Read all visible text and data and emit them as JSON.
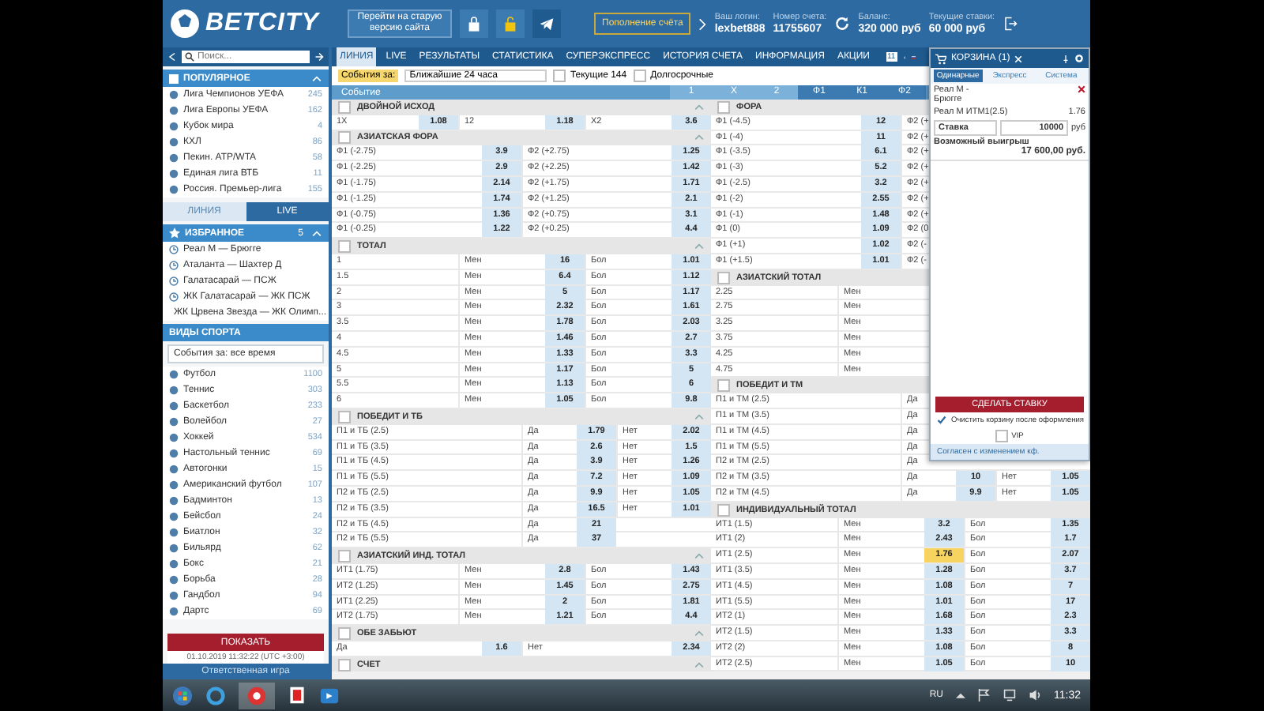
{
  "header": {
    "logo": "BETCITY",
    "old_site_button": "Перейти на старую версию сайта",
    "deposit_button": "Пополнение счёта",
    "account": [
      {
        "label": "Ваш логин:",
        "value": "lexbet888"
      },
      {
        "label": "Номер счета:",
        "value": "11755607"
      },
      {
        "label": "Баланс:",
        "value": "320 000 руб"
      },
      {
        "label": "Текущие ставки:",
        "value": "60 000 руб"
      }
    ]
  },
  "nav": {
    "search_placeholder": "Поиск...",
    "badge": "11",
    "items": [
      {
        "label": "ЛИНИЯ",
        "selected": true
      },
      {
        "label": "LIVE",
        "selected": false
      },
      {
        "label": "РЕЗУЛЬТАТЫ",
        "selected": false
      },
      {
        "label": "СТАТИСТИКА",
        "selected": false
      },
      {
        "label": "СУПЕРЭКСПРЕСС",
        "selected": false
      },
      {
        "label": "ИСТОРИЯ СЧЕТА",
        "selected": false
      },
      {
        "label": "ИНФОРМАЦИЯ",
        "selected": false
      },
      {
        "label": "АКЦИИ",
        "selected": false
      }
    ]
  },
  "sidebar": {
    "popular": {
      "title": "ПОПУЛЯРНОЕ",
      "items": [
        {
          "name": "Лига Чемпионов УЕФА",
          "count": "245"
        },
        {
          "name": "Лига Европы УЕФА",
          "count": "162"
        },
        {
          "name": "Кубок мира",
          "count": "4"
        },
        {
          "name": "КХЛ",
          "count": "86"
        },
        {
          "name": "Пекин. ATP/WTA",
          "count": "58"
        },
        {
          "name": "Единая лига ВТБ",
          "count": "11"
        },
        {
          "name": "Россия. Премьер-лига",
          "count": "155"
        }
      ]
    },
    "tabs": [
      {
        "label": "ЛИНИЯ",
        "selected": false
      },
      {
        "label": "LIVE",
        "selected": true
      }
    ],
    "favorites": {
      "title": "ИЗБРАННОЕ",
      "count": "5",
      "items": [
        "Реал М — Брюгге",
        "Аталанта — Шахтер Д",
        "Галатасарай — ПСЖ",
        "ЖК Галатасарай — ЖК ПСЖ",
        "ЖК Црвена Звезда — ЖК Олимп..."
      ]
    },
    "sports": {
      "title": "ВИДЫ СПОРТА",
      "filter": "События за: все время",
      "items": [
        {
          "name": "Футбол",
          "count": "1100"
        },
        {
          "name": "Теннис",
          "count": "303"
        },
        {
          "name": "Баскетбол",
          "count": "233"
        },
        {
          "name": "Волейбол",
          "count": "27"
        },
        {
          "name": "Хоккей",
          "count": "534"
        },
        {
          "name": "Настольный теннис",
          "count": "69"
        },
        {
          "name": "Автогонки",
          "count": "15"
        },
        {
          "name": "Американский футбол",
          "count": "107"
        },
        {
          "name": "Бадминтон",
          "count": "13"
        },
        {
          "name": "Бейсбол",
          "count": "24"
        },
        {
          "name": "Биатлон",
          "count": "32"
        },
        {
          "name": "Бильярд",
          "count": "62"
        },
        {
          "name": "Бокс",
          "count": "21"
        },
        {
          "name": "Борьба",
          "count": "28"
        },
        {
          "name": "Гандбол",
          "count": "94"
        },
        {
          "name": "Дартс",
          "count": "69"
        }
      ]
    },
    "show_button": "ПОКАЗАТЬ",
    "datetime": "01.10.2019 11:32:22 (UTC +3:00)",
    "responsible": "Ответственная игра"
  },
  "filter": {
    "label": "События за:",
    "period": "Ближайшие 24 часа",
    "options": [
      {
        "label": "Текущие 144",
        "checked": false
      },
      {
        "label": "Долгосрочные",
        "checked": false
      }
    ]
  },
  "columns": {
    "event": "Событие",
    "odds": [
      {
        "label": "1",
        "kind": "outcome"
      },
      {
        "label": "X",
        "kind": "outcome"
      },
      {
        "label": "2",
        "kind": "outcome"
      },
      {
        "label": "Ф1",
        "kind": "handicap"
      },
      {
        "label": "К1",
        "kind": "handicap"
      },
      {
        "label": "Ф2",
        "kind": "handicap"
      }
    ]
  },
  "markets": {
    "left": [
      {
        "title": "ДВОЙНОЙ ИСХОД",
        "kind": "pairs3",
        "checked": false,
        "rows": [
          {
            "cells": [
              "1X",
              "1.08",
              "12",
              "1.18",
              "X2",
              "3.6"
            ]
          }
        ]
      },
      {
        "title": "АЗИАТСКАЯ ФОРА",
        "kind": "pairs2",
        "checked": false,
        "rows": [
          {
            "cells": [
              "Ф1 (-2.75)",
              "3.9",
              "Ф2 (+2.75)",
              "1.25"
            ]
          },
          {
            "cells": [
              "Ф1 (-2.25)",
              "2.9",
              "Ф2 (+2.25)",
              "1.42"
            ]
          },
          {
            "cells": [
              "Ф1 (-1.75)",
              "2.14",
              "Ф2 (+1.75)",
              "1.71"
            ]
          },
          {
            "cells": [
              "Ф1 (-1.25)",
              "1.74",
              "Ф2 (+1.25)",
              "2.1"
            ]
          },
          {
            "cells": [
              "Ф1 (-0.75)",
              "1.36",
              "Ф2 (+0.75)",
              "3.1"
            ]
          },
          {
            "cells": [
              "Ф1 (-0.25)",
              "1.22",
              "Ф2 (+0.25)",
              "4.4"
            ]
          }
        ]
      },
      {
        "title": "ТОТАЛ",
        "kind": "total",
        "checked": false,
        "rows": [
          {
            "cells": [
              "1",
              "Мен",
              "16",
              "Бол",
              "1.01"
            ]
          },
          {
            "cells": [
              "1.5",
              "Мен",
              "6.4",
              "Бол",
              "1.12"
            ]
          },
          {
            "cells": [
              "2",
              "Мен",
              "5",
              "Бол",
              "1.17"
            ]
          },
          {
            "cells": [
              "3",
              "Мен",
              "2.32",
              "Бол",
              "1.61"
            ]
          },
          {
            "cells": [
              "3.5",
              "Мен",
              "1.78",
              "Бол",
              "2.03"
            ]
          },
          {
            "cells": [
              "4",
              "Мен",
              "1.46",
              "Бол",
              "2.7"
            ]
          },
          {
            "cells": [
              "4.5",
              "Мен",
              "1.33",
              "Бол",
              "3.3"
            ]
          },
          {
            "cells": [
              "5",
              "Мен",
              "1.17",
              "Бол",
              "5"
            ]
          },
          {
            "cells": [
              "5.5",
              "Мен",
              "1.13",
              "Бол",
              "6"
            ]
          },
          {
            "cells": [
              "6",
              "Мен",
              "1.05",
              "Бол",
              "9.8"
            ]
          }
        ]
      },
      {
        "title": "ПОБЕДИТ И ТБ",
        "kind": "yesno",
        "checked": false,
        "rows": [
          {
            "cells": [
              "П1 и ТБ (2.5)",
              "Да",
              "1.79",
              "Нет",
              "2.02"
            ]
          },
          {
            "cells": [
              "П1 и ТБ (3.5)",
              "Да",
              "2.6",
              "Нет",
              "1.5"
            ]
          },
          {
            "cells": [
              "П1 и ТБ (4.5)",
              "Да",
              "3.9",
              "Нет",
              "1.26"
            ]
          },
          {
            "cells": [
              "П1 и ТБ (5.5)",
              "Да",
              "7.2",
              "Нет",
              "1.09"
            ]
          },
          {
            "cells": [
              "П2 и ТБ (2.5)",
              "Да",
              "9.9",
              "Нет",
              "1.05"
            ]
          },
          {
            "cells": [
              "П2 и ТБ (3.5)",
              "Да",
              "16.5",
              "Нет",
              "1.01"
            ]
          },
          {
            "cells": [
              "П2 и ТБ (4.5)",
              "Да",
              "21"
            ]
          },
          {
            "cells": [
              "П2 и ТБ (5.5)",
              "Да",
              "37"
            ]
          }
        ]
      },
      {
        "title": "АЗИАТСКИЙ ИНД. ТОТАЛ",
        "kind": "total",
        "checked": false,
        "rows": [
          {
            "cells": [
              "ИТ1 (1.75)",
              "Мен",
              "2.8",
              "Бол",
              "1.43"
            ]
          },
          {
            "cells": [
              "ИТ2 (1.25)",
              "Мен",
              "1.45",
              "Бол",
              "2.75"
            ]
          },
          {
            "cells": [
              "ИТ1 (2.25)",
              "Мен",
              "2",
              "Бол",
              "1.81"
            ]
          },
          {
            "cells": [
              "ИТ2 (1.75)",
              "Мен",
              "1.21",
              "Бол",
              "4.4"
            ]
          }
        ]
      },
      {
        "title": "ОБЕ ЗАБЬЮТ",
        "kind": "pairs2",
        "checked": false,
        "rows": [
          {
            "cells": [
              "Да",
              "1.6",
              "Нет",
              "2.34"
            ]
          }
        ]
      },
      {
        "title": "СЧЕТ",
        "checked": false
      }
    ],
    "right": [
      {
        "title": "ФОРА",
        "kind": "pairs2",
        "checked": false,
        "rows": [
          {
            "cells": [
              "Ф1 (-4.5)",
              "12",
              "Ф2 (+"
            ]
          },
          {
            "cells": [
              "Ф1 (-4)",
              "11",
              "Ф2 (+"
            ]
          },
          {
            "cells": [
              "Ф1 (-3.5)",
              "6.1",
              "Ф2 (+"
            ]
          },
          {
            "cells": [
              "Ф1 (-3)",
              "5.2",
              "Ф2 (+"
            ]
          },
          {
            "cells": [
              "Ф1 (-2.5)",
              "3.2",
              "Ф2 (+"
            ]
          },
          {
            "cells": [
              "Ф1 (-2)",
              "2.55",
              "Ф2 (+"
            ]
          },
          {
            "cells": [
              "Ф1 (-1)",
              "1.48",
              "Ф2 (+"
            ]
          },
          {
            "cells": [
              "Ф1 (0)",
              "1.09",
              "Ф2 (0"
            ]
          },
          {
            "cells": [
              "Ф1 (+1)",
              "1.02",
              "Ф2 (-"
            ]
          },
          {
            "cells": [
              "Ф1 (+1.5)",
              "1.01",
              "Ф2 (-"
            ]
          }
        ]
      },
      {
        "title": "АЗИАТСКИЙ ТОТАЛ",
        "kind": "total",
        "checked": false,
        "rows": [
          {
            "cells": [
              "2.25",
              "Мен"
            ]
          },
          {
            "cells": [
              "2.75",
              "Мен"
            ]
          },
          {
            "cells": [
              "3.25",
              "Мен"
            ]
          },
          {
            "cells": [
              "3.75",
              "Мен"
            ]
          },
          {
            "cells": [
              "4.25",
              "Мен"
            ]
          },
          {
            "cells": [
              "4.75",
              "Мен"
            ]
          }
        ]
      },
      {
        "title": "ПОБЕДИТ И ТМ",
        "kind": "yesno",
        "checked": false,
        "rows": [
          {
            "cells": [
              "П1 и ТМ (2.5)",
              "Да"
            ]
          },
          {
            "cells": [
              "П1 и ТМ (3.5)",
              "Да"
            ]
          },
          {
            "cells": [
              "П1 и ТМ (4.5)",
              "Да"
            ]
          },
          {
            "cells": [
              "П1 и ТМ (5.5)",
              "Да"
            ]
          },
          {
            "cells": [
              "П2 и ТМ (2.5)",
              "Да"
            ]
          },
          {
            "cells": [
              "П2 и ТМ (3.5)",
              "Да",
              "10",
              "Нет",
              "1.05"
            ]
          },
          {
            "cells": [
              "П2 и ТМ (4.5)",
              "Да",
              "9.9",
              "Нет",
              "1.05"
            ]
          }
        ]
      },
      {
        "title": "ИНДИВИДУАЛЬНЫЙ ТОТАЛ",
        "kind": "total",
        "checked": false,
        "rows": [
          {
            "cells": [
              "ИТ1 (1.5)",
              "Мен",
              "3.2",
              "Бол",
              "1.35"
            ],
            "selected": false
          },
          {
            "cells": [
              "ИТ1 (2)",
              "Мен",
              "2.43",
              "Бол",
              "1.7"
            ],
            "selected": false
          },
          {
            "cells": [
              "ИТ1 (2.5)",
              "Мен",
              "1.76",
              "Бол",
              "2.07"
            ],
            "selected": true
          },
          {
            "cells": [
              "ИТ1 (3.5)",
              "Мен",
              "1.28",
              "Бол",
              "3.7"
            ],
            "selected": false
          },
          {
            "cells": [
              "ИТ1 (4.5)",
              "Мен",
              "1.08",
              "Бол",
              "7"
            ],
            "selected": false
          },
          {
            "cells": [
              "ИТ1 (5.5)",
              "Мен",
              "1.01",
              "Бол",
              "17"
            ],
            "selected": false
          },
          {
            "cells": [
              "ИТ2 (1)",
              "Мен",
              "1.68",
              "Бол",
              "2.3"
            ],
            "selected": false
          },
          {
            "cells": [
              "ИТ2 (1.5)",
              "Мен",
              "1.33",
              "Бол",
              "3.3"
            ],
            "selected": false
          },
          {
            "cells": [
              "ИТ2 (2)",
              "Мен",
              "1.08",
              "Бол",
              "8"
            ],
            "selected": false
          },
          {
            "cells": [
              "ИТ2 (2.5)",
              "Мен",
              "1.05",
              "Бол",
              "10"
            ],
            "selected": false
          }
        ]
      }
    ]
  },
  "betslip": {
    "title": "КОРЗИНА (1)",
    "tabs": [
      {
        "label": "Одинарные",
        "selected": true
      },
      {
        "label": "Экспресс",
        "selected": false
      },
      {
        "label": "Система",
        "selected": false
      }
    ],
    "event": "Реал М - Брюгге",
    "bet": "Реал М ИТМ1(2.5)",
    "odd": "1.76",
    "stake_type": "Ставка",
    "stake": "10000",
    "currency": "руб",
    "win_label": "Возможный выигрыш",
    "win_value": "17 600,00 руб.",
    "submit": "СДЕЛАТЬ СТАВКУ",
    "options": [
      {
        "label": "Очистить корзину после оформления",
        "checked": true
      },
      {
        "label": "VIP",
        "checked": false
      }
    ],
    "agree": "Согласен с изменением кф."
  },
  "taskbar": {
    "language": "RU",
    "time": "11:32"
  }
}
